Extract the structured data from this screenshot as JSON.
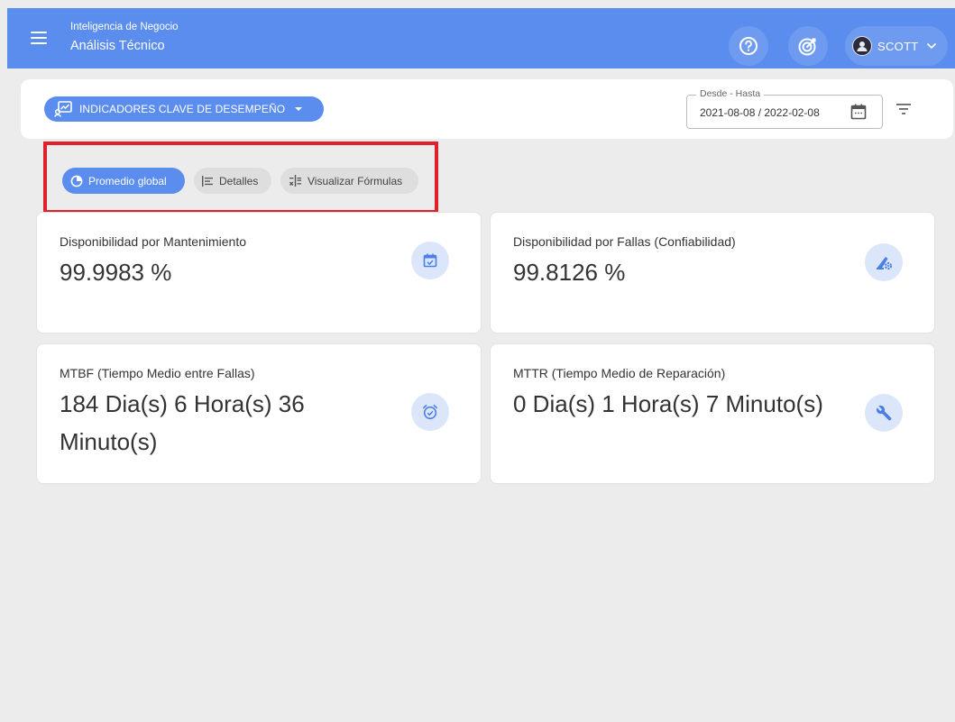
{
  "header": {
    "app_subtitle": "Inteligencia de Negocio",
    "app_title": "Análisis Técnico",
    "user": {
      "name": "SCOTT"
    },
    "colors": {
      "brand": "#5b8def",
      "icon_bg": "#dce6fb"
    }
  },
  "filters": {
    "kpi_selector_label": "INDICADORES CLAVE DE DESEMPEÑO",
    "date_range": {
      "label": "Desde - Hasta",
      "value": "2021-08-08 / 2022-02-08"
    }
  },
  "view_tabs": [
    {
      "label": "Promedio global",
      "icon": "pie-chart-icon",
      "active": true
    },
    {
      "label": "Detalles",
      "icon": "list-icon",
      "active": false
    },
    {
      "label": "Visualizar Fórmulas",
      "icon": "formula-icon",
      "active": false
    }
  ],
  "cards": [
    {
      "title": "Disponibilidad por Mantenimiento",
      "value": "99.9983 %",
      "icon": "calendar-check-icon"
    },
    {
      "title": "Disponibilidad por Fallas (Confiabilidad)",
      "value": "99.8126 %",
      "icon": "wrench-gear-icon"
    },
    {
      "title": "MTBF (Tiempo Medio entre Fallas)",
      "value": "184 Dia(s) 6 Hora(s) 36 Minuto(s)",
      "icon": "alarm-clock-icon"
    },
    {
      "title": "MTTR (Tiempo Medio de Reparación)",
      "value": "0 Dia(s) 1 Hora(s) 7 Minuto(s)",
      "icon": "wrench-icon"
    }
  ]
}
